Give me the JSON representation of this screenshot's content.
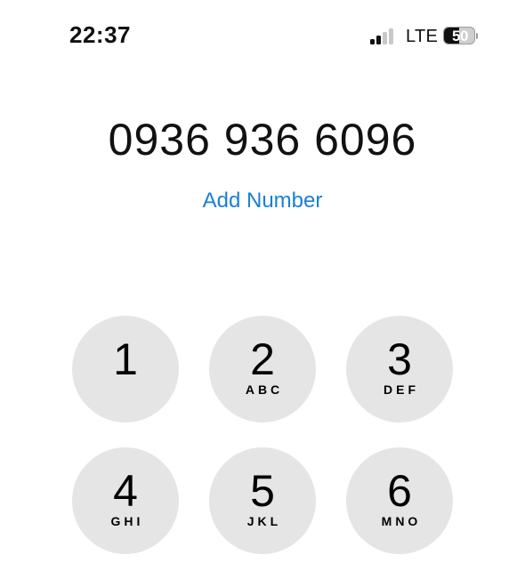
{
  "status_bar": {
    "time": "22:37",
    "network": "LTE",
    "battery_percent": "50",
    "battery_level": 0.5,
    "signal_bars_active": 2,
    "signal_bars_total": 4
  },
  "dialer": {
    "number": "0936 936 6096",
    "add_number_label": "Add Number",
    "accent_color": "#1a7fd4",
    "key_background": "#e5e5e5"
  },
  "keypad": [
    {
      "digit": "1",
      "letters": ""
    },
    {
      "digit": "2",
      "letters": "ABC"
    },
    {
      "digit": "3",
      "letters": "DEF"
    },
    {
      "digit": "4",
      "letters": "GHI"
    },
    {
      "digit": "5",
      "letters": "JKL"
    },
    {
      "digit": "6",
      "letters": "MNO"
    }
  ]
}
